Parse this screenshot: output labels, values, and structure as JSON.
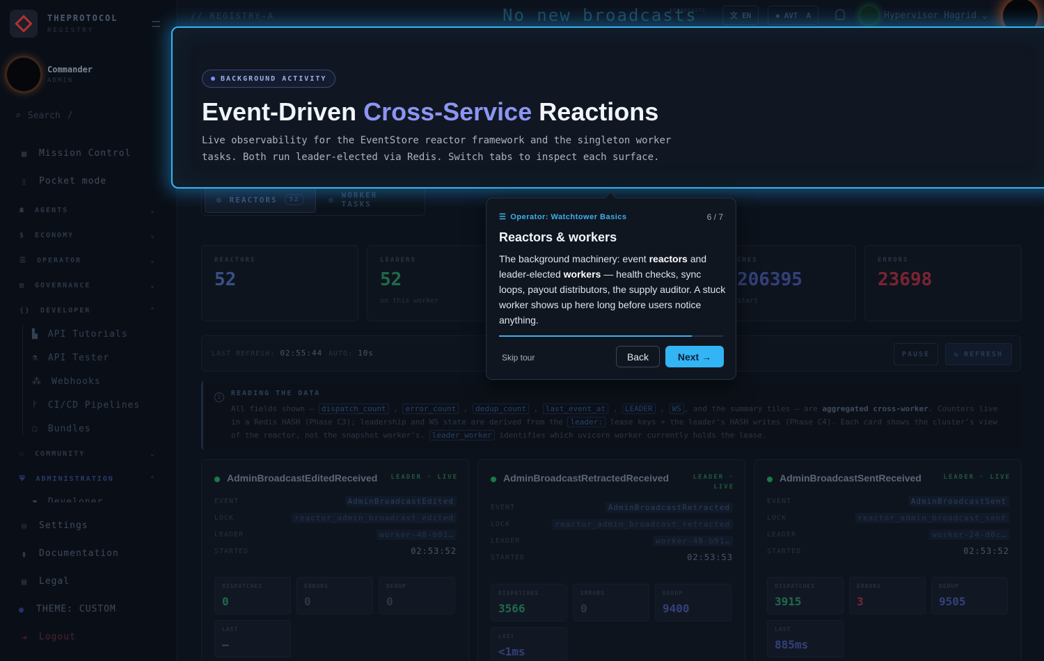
{
  "brand": {
    "name": "THEPROTOCOL",
    "sub": "REGISTRY"
  },
  "user": {
    "name": "Commander",
    "role": "ADMIN"
  },
  "search": {
    "label": "Search",
    "shortcut": "/"
  },
  "nav": {
    "mission": "Mission Control",
    "pocket": "Pocket mode",
    "sections": [
      "AGENTS",
      "ECONOMY",
      "OPERATOR",
      "GOVERNANCE",
      "DEVELOPER"
    ],
    "developer_items": [
      "API Tutorials",
      "API Tester",
      "Webhooks",
      "CI/CD Pipelines",
      "Bundles"
    ],
    "community": "COMMUNITY",
    "administration": "ADMINISTRATION",
    "admin_partial": "Developer",
    "settings": "Settings",
    "documentation": "Documentation",
    "legal": "Legal",
    "theme": "THEME: CUSTOM",
    "logout": "Logout"
  },
  "topbar": {
    "crumb": "// REGISTRY-A",
    "broadcast": "No new broadcasts",
    "broadcast_label": "BROADCASTS",
    "lang": "EN",
    "avt": "AVT",
    "avt_suffix": "A",
    "account": "Hypervisor Hagrid"
  },
  "hero": {
    "badge": "BACKGROUND ACTIVITY",
    "title_a": "Event-Driven ",
    "title_accent": "Cross-Service",
    "title_b": " Reactions",
    "desc": "Live observability for the EventStore reactor framework and the singleton worker tasks. Both run leader-elected via Redis. Switch tabs to inspect each surface."
  },
  "tabs": {
    "reactors": "REACTORS",
    "reactors_count": "52",
    "workers": "WORKER TASKS"
  },
  "tiles": [
    {
      "label": "REACTORS",
      "value": "52",
      "sub": "",
      "color": "#3a4f86"
    },
    {
      "label": "LEADERS",
      "value": "52",
      "sub": "on this worker",
      "color": "#1f6a4a"
    },
    {
      "label": "CHES",
      "value": "206395",
      "sub": "start",
      "color": "#34407a"
    },
    {
      "label": "ERRORS",
      "value": "23698",
      "sub": "",
      "color": "#7a2432"
    }
  ],
  "refresh": {
    "last_label": "LAST REFRESH:",
    "last_value": "02:55:44",
    "auto_label": "AUTO:",
    "auto_value": "10s",
    "pause": "PAUSE",
    "refresh": "REFRESH"
  },
  "info": {
    "heading": "READING THE DATA",
    "t1": "All fields shown — ",
    "c1": "dispatch_count",
    "c2": "error_count",
    "c3": "dedup_count",
    "c4": "last_event_at",
    "c5": "LEADER",
    "c6": "WS",
    "t2": ", and the summary tiles — are ",
    "bold": "aggregated cross-worker",
    "t3": ". Counters live in a Redis HASH (Phase C3); leadership and WS state are derived from the ",
    "c7": "leader:",
    "t4": " lease keys + the leader's HASH writes (Phase C4). Each card shows the cluster's view of the reactor, not the snapshot worker's. ",
    "c8": "leader_worker",
    "t5": " identifies which uvicorn worker currently holds the lease."
  },
  "card_labels": {
    "event": "EVENT",
    "lock": "LOCK",
    "leader": "LEADER",
    "started": "STARTED",
    "dispatches": "DISPATCHES",
    "errors": "ERRORS",
    "dedup": "DEDUP",
    "last": "LAST"
  },
  "cards": [
    {
      "name": "AdminBroadcastEditedReceived",
      "status": "LEADER · LIVE",
      "event": "AdminBroadcastEdited",
      "lock": "reactor_admin_broadcast_edited",
      "leader": "worker-48-b91…",
      "started": "02:53:52",
      "dispatches": "0",
      "errors": "0",
      "dedup": "0",
      "last": "—"
    },
    {
      "name": "AdminBroadcastRetractedReceived",
      "status": "LEADER · LIVE",
      "event": "AdminBroadcastRetracted",
      "lock": "reactor_admin_broadcast_retracted",
      "leader": "worker-48-b91…",
      "started": "02:53:53",
      "dispatches": "3566",
      "errors": "0",
      "dedup": "9400",
      "last": "<1ms"
    },
    {
      "name": "AdminBroadcastSentReceived",
      "status": "LEADER · LIVE",
      "event": "AdminBroadcastSent",
      "lock": "reactor_admin_broadcast_sent",
      "leader": "worker-24-d0c…",
      "started": "02:53:52",
      "dispatches": "3915",
      "errors": "3",
      "dedup": "9505",
      "last": "885ms"
    }
  ],
  "tour": {
    "kicker": "Operator: Watchtower Basics",
    "step": "6 / 7",
    "progress": 0.86,
    "title": "Reactors & workers",
    "b1": "The background machinery: event ",
    "b2": "reactors",
    "b3": " and leader-elected ",
    "b4": "workers",
    "b5": " — health checks, sync loops, payout distributors, the supply auditor. A stuck worker shows up here long before users notice anything.",
    "skip": "Skip tour",
    "back": "Back",
    "next": "Next →"
  }
}
